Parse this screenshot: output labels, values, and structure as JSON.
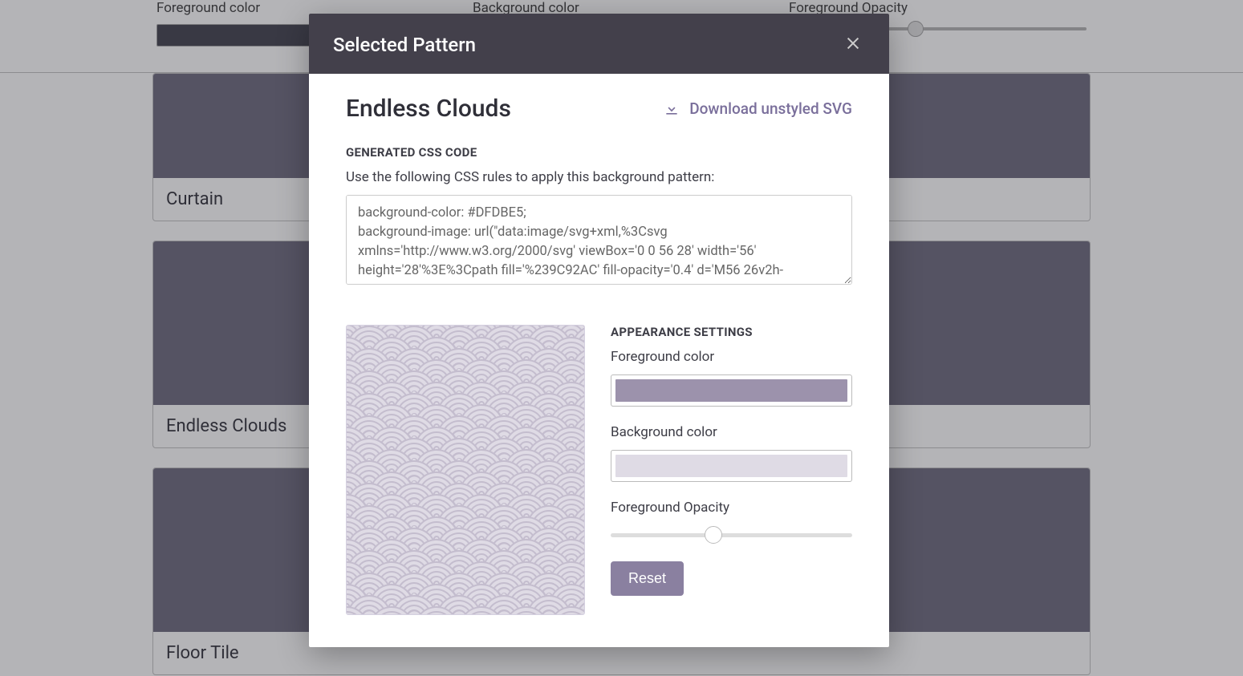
{
  "background": {
    "controls": {
      "fg_label": "Foreground color",
      "bg_label": "Background color",
      "opacity_label": "Foreground Opacity"
    },
    "cards": [
      {
        "name": "Curtain"
      },
      {
        "name": "Endless Clouds"
      },
      {
        "name": "Floor Tile"
      }
    ]
  },
  "modal": {
    "header_title": "Selected Pattern",
    "pattern_name": "Endless Clouds",
    "download_label": "Download unstyled SVG",
    "css_section_label": "GENERATED CSS CODE",
    "css_hint": "Use the following CSS rules to apply this background pattern:",
    "css_code": "background-color: #DFDBE5;\nbackground-image: url(\"data:image/svg+xml,%3Csvg xmlns='http://www.w3.org/2000/svg' viewBox='0 0 56 28' width='56' height='28'%3E%3Cpath fill='%239C92AC' fill-opacity='0.4' d='M56 26v2h-",
    "appearance": {
      "section_label": "APPEARANCE SETTINGS",
      "fg_label": "Foreground color",
      "fg_value": "#9C92AC",
      "bg_label": "Background color",
      "bg_value": "#DFDBE5",
      "opacity_label": "Foreground Opacity",
      "opacity_value": 0.4,
      "reset_label": "Reset"
    }
  }
}
